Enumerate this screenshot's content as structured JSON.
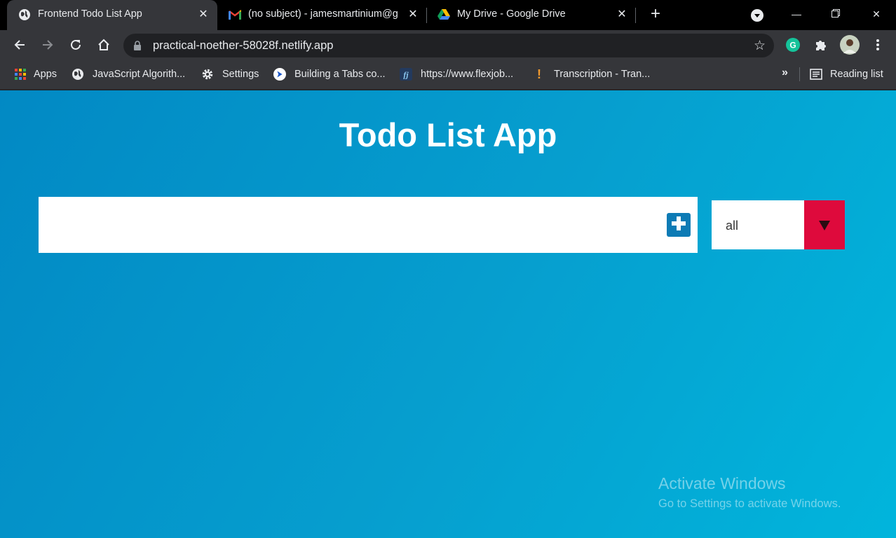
{
  "browser": {
    "tabs": [
      {
        "title": "Frontend Todo List App",
        "icon": "globe-icon",
        "active": true
      },
      {
        "title": "(no subject) - jamesmartinium@g",
        "icon": "gmail-icon",
        "active": false
      },
      {
        "title": "My Drive - Google Drive",
        "icon": "google-drive-icon",
        "active": false
      }
    ],
    "url": "practical-noether-58028f.netlify.app",
    "bookmarks": [
      {
        "label": "Apps",
        "icon": "apps-grid-icon"
      },
      {
        "label": "JavaScript Algorith...",
        "icon": "globe-icon"
      },
      {
        "label": "Settings",
        "icon": "gear-icon"
      },
      {
        "label": "Building a Tabs co...",
        "icon": "chevron-badge-icon"
      },
      {
        "label": "https://www.flexjob...",
        "icon": "flexjobs-icon"
      },
      {
        "label": "Transcription - Tran...",
        "icon": "exclamation-icon"
      }
    ],
    "more_bookmarks": "»",
    "reading_list": "Reading list"
  },
  "app": {
    "title": "Todo List App",
    "todo_input": {
      "value": "",
      "placeholder": ""
    },
    "filter": {
      "selected": "all"
    }
  },
  "os_watermark": {
    "line1": "Activate Windows",
    "line2": "Go to Settings to activate Windows."
  },
  "colors": {
    "accent_add": "#0d7bb5",
    "accent_filter": "#de0a3c",
    "bg_start": "#0289c4",
    "bg_end": "#01b5dc"
  }
}
